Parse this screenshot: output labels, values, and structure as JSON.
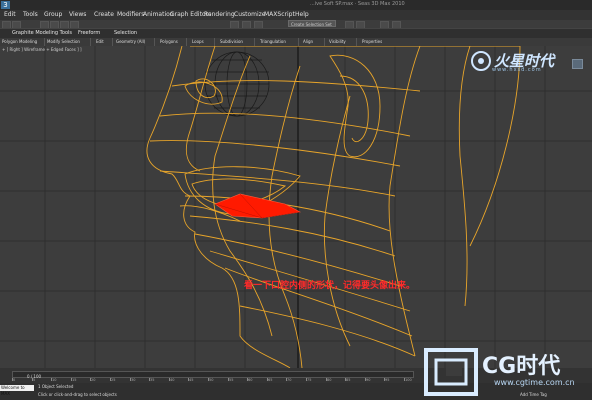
{
  "app": {
    "logo": "3",
    "window_title": "...ive Soft SP.max · Seas 3D Max 2010"
  },
  "menu": [
    {
      "id": "edit",
      "label": "Edit"
    },
    {
      "id": "tools",
      "label": "Tools"
    },
    {
      "id": "group",
      "label": "Group"
    },
    {
      "id": "views",
      "label": "Views"
    },
    {
      "id": "create",
      "label": "Create"
    },
    {
      "id": "modifiers",
      "label": "Modifiers"
    },
    {
      "id": "animation",
      "label": "Animation"
    },
    {
      "id": "graph",
      "label": "Graph Editors"
    },
    {
      "id": "rendering",
      "label": "Rendering"
    },
    {
      "id": "customize",
      "label": "Customize"
    },
    {
      "id": "maxscript",
      "label": "MAXScript"
    },
    {
      "id": "help",
      "label": "Help"
    }
  ],
  "toolbar": {
    "selection_set": "Create Selection Set"
  },
  "ribbon": {
    "tabs": [
      {
        "label": "Graphite Modeling Tools"
      },
      {
        "label": "Freeform"
      },
      {
        "label": "Selection"
      }
    ],
    "panels": [
      {
        "label": "Polygon Modeling"
      },
      {
        "label": "Modify Selection"
      },
      {
        "label": "Edit"
      },
      {
        "label": "Geometry (All)"
      },
      {
        "label": "Polygons"
      },
      {
        "label": "Loops"
      },
      {
        "label": "Subdivision"
      },
      {
        "label": "Triangulation"
      },
      {
        "label": "Align"
      },
      {
        "label": "Visibility"
      },
      {
        "label": "Properties"
      }
    ]
  },
  "viewport": {
    "label": "+ ] Right ] Wireframe + Edged Faces ] ]",
    "caption": "看一下口腔内侧的形状，记得要头像出来。"
  },
  "watermark": {
    "brand": "火星时代",
    "url": "www.hxsd.com"
  },
  "timeline": {
    "frame": "0 / 100",
    "ticks": [
      "0",
      "5",
      "10",
      "15",
      "20",
      "25",
      "30",
      "35",
      "40",
      "45",
      "50",
      "55",
      "60",
      "65",
      "70",
      "75",
      "80",
      "85",
      "90",
      "95",
      "100"
    ]
  },
  "status": {
    "maxscript": "Welcome to MAX",
    "selection": "1 Object Selected",
    "prompt": "Click or click-and-drag to select objects",
    "add_time_tag": "Add Time Tag"
  },
  "cg_logo": {
    "text": "CG时代",
    "url": "www.cgtime.com.cn"
  },
  "colors": {
    "wire": "#e8a52a",
    "selection": "#ff1a00",
    "eye": "#1a1a1a",
    "caption": "#ff2a2a"
  }
}
